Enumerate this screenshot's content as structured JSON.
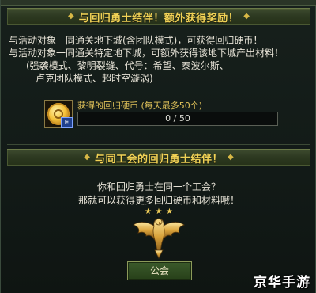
{
  "section1": {
    "title": "与回归勇士结伴！额外获得奖励！",
    "lines": [
      "与活动对象一同通关地下城(含团队模式)，可获得回归硬币！",
      "与活动对象一同通关特定地下城，可额外获得该地下城产出材料！",
      "(强袭模式、黎明裂缝、代号：希望、泰波尔斯、",
      "卢克团队模式、超时空漩涡)"
    ],
    "reward": {
      "icon": "return-coin-icon",
      "badge": "E",
      "label": "获得的回归硬币",
      "note": "(每天最多50个)",
      "progress_text": "0 / 50",
      "current": 0,
      "max": 50
    }
  },
  "section2": {
    "title": "与同工会的回归勇士结伴！",
    "lines": [
      "你和回归勇士在同一个工会？",
      "那就可以获得更多回归硬币和材料哦！"
    ],
    "emblem": "guild-eagle-emblem-icon",
    "button_label": "公会"
  },
  "watermark": "京华手游",
  "colors": {
    "banner_title": "#f1d256",
    "reward_label": "#e3c45a",
    "text": "#e6e2d6",
    "background": "#121a17"
  }
}
